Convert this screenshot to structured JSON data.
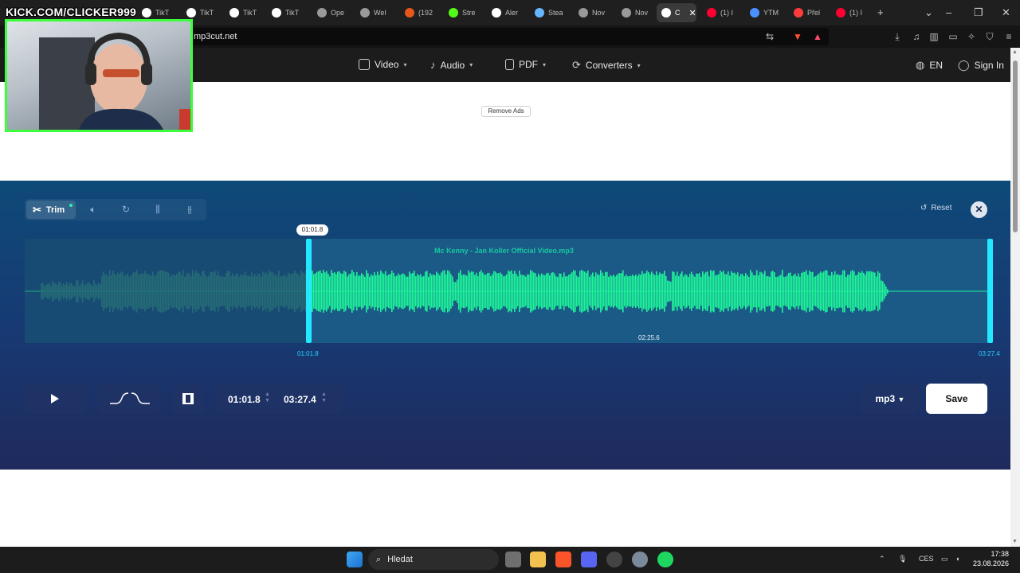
{
  "overlay": {
    "streamer_banner": "KICK.COM/CLICKER999"
  },
  "browser": {
    "tabs": [
      {
        "label": "TikT",
        "fav_color": "#ffffff"
      },
      {
        "label": "TikT",
        "fav_color": "#ffffff"
      },
      {
        "label": "TikT",
        "fav_color": "#ffffff"
      },
      {
        "label": "TikT",
        "fav_color": "#ffffff"
      },
      {
        "label": "Ope",
        "fav_color": "#9a9a9a"
      },
      {
        "label": "Wel",
        "fav_color": "#9a9a9a"
      },
      {
        "label": "(192",
        "fav_color": "#e8561c"
      },
      {
        "label": "Stre",
        "fav_color": "#53fc18"
      },
      {
        "label": "Aler",
        "fav_color": "#ffffff"
      },
      {
        "label": "Stea",
        "fav_color": "#66b6ff"
      },
      {
        "label": "Nov",
        "fav_color": "#9a9a9a"
      },
      {
        "label": "Nov",
        "fav_color": "#9a9a9a"
      },
      {
        "label": "C",
        "fav_color": "#ffffff"
      },
      {
        "label": "(1) I",
        "fav_color": "#ff0033"
      },
      {
        "label": "YTM",
        "fav_color": "#4a90ff"
      },
      {
        "label": "Přel",
        "fav_color": "#ff3b3b"
      },
      {
        "label": "(1) I",
        "fav_color": "#ff0033"
      }
    ],
    "active_tab_index": 12,
    "new_tab_label": "+",
    "url": "mp3cut.net"
  },
  "site_nav": {
    "items": [
      {
        "label": "Video",
        "icon": "video-icon"
      },
      {
        "label": "Audio",
        "icon": "music-note-icon"
      },
      {
        "label": "PDF",
        "icon": "document-icon"
      },
      {
        "label": "Converters",
        "icon": "refresh-icon"
      }
    ],
    "language": "EN",
    "sign_in": "Sign In"
  },
  "ad": {
    "remove_ads_label": "Remove Ads"
  },
  "editor": {
    "toolbar": {
      "trim_label": "Trim",
      "tools": [
        "volume-icon",
        "speed-icon",
        "equalizer-icon",
        "sliders-icon"
      ]
    },
    "reset_label": "Reset",
    "file_name": "Mc Kenny - Jan Koller Official Video.mp3",
    "playhead_time": "01:01.8",
    "selection_start": "01:01.8",
    "selection_end": "03:27.4",
    "selection_duration": "02:25.6",
    "start_time_field": "01:01.8",
    "end_time_field": "03:27.4",
    "format": "mp3",
    "save_label": "Save",
    "colors": {
      "wave_active": "#1ef59a",
      "wave_inactive": "#2f8b8a",
      "handle": "#23e8ff",
      "panel": "#1b5a86"
    }
  },
  "taskbar": {
    "search_placeholder": "Hledat",
    "language": "CES",
    "time": "17:38",
    "date": "23.08.2026"
  }
}
